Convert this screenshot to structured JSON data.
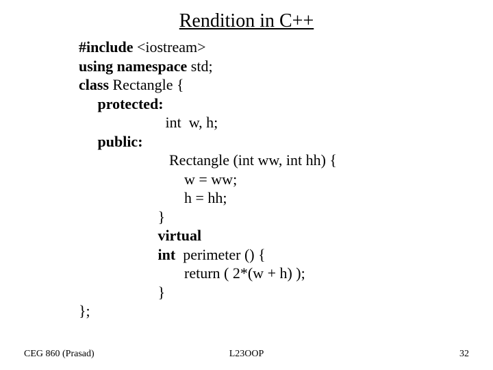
{
  "title": "Rendition in C++",
  "code": {
    "l1a": "#include ",
    "l1b": "<iostream>",
    "l2a": "using namespace ",
    "l2b": "std;",
    "l3a": "class ",
    "l3b": "Rectangle {",
    "l4": "     protected:",
    "l5": "                       int  w, h;",
    "l6": "     public:",
    "l7": "                        Rectangle (int ww, int hh) {",
    "l8": "                            w = ww;",
    "l9": "                            h = hh;",
    "l10": "                     }",
    "l11": "                     virtual",
    "l12a": "                     int  ",
    "l12b": "perimeter () {",
    "l13": "                            return ( 2*(w + h) );",
    "l14": "                     }",
    "l15": "};"
  },
  "footer": {
    "left": "CEG 860  (Prasad)",
    "center": "L23OOP",
    "right": "32"
  }
}
